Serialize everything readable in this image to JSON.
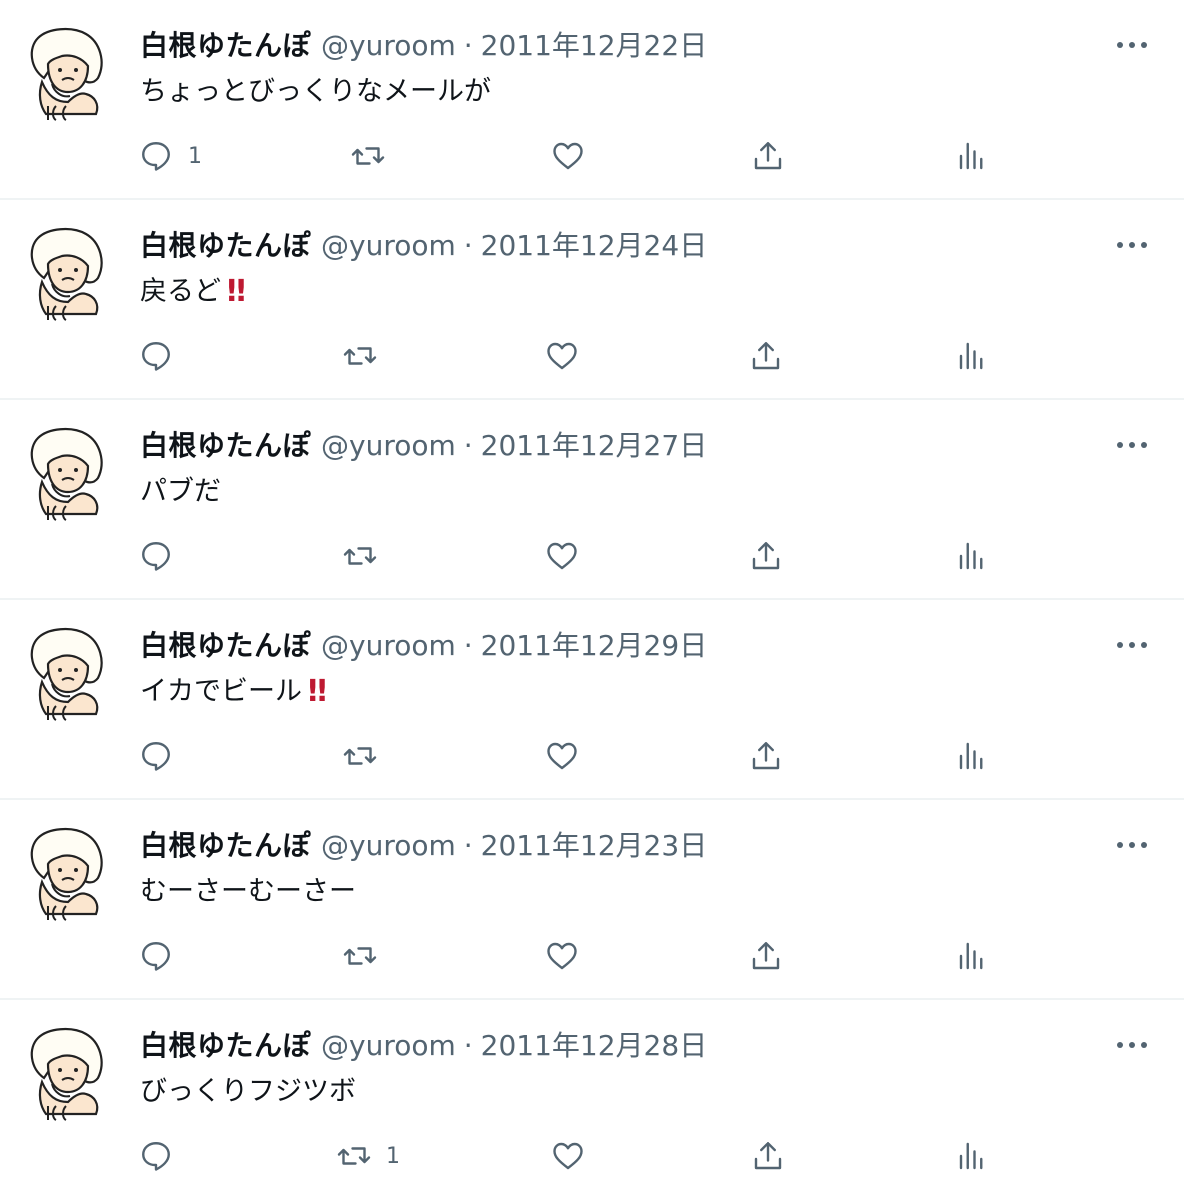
{
  "colors": {
    "text": "#0f1419",
    "secondary": "#536471",
    "divider": "#eff3f4",
    "emoji_red": "#be1931"
  },
  "icons": {
    "reply": "speech-bubble-icon",
    "retweet": "retweet-arrows-icon",
    "like": "heart-icon",
    "share": "share-upload-icon",
    "views": "bar-chart-icon",
    "more": "more-horizontal-icon"
  },
  "tweets": [
    {
      "name": "白根ゆたんぽ",
      "handle": "@yuroom",
      "separator": "·",
      "date": "2011年12月22日",
      "text": "ちょっとびっくりなメールが",
      "emoji": "",
      "reply_count": "1",
      "retweet_count": ""
    },
    {
      "name": "白根ゆたんぽ",
      "handle": "@yuroom",
      "separator": "·",
      "date": "2011年12月24日",
      "text": "戻るど",
      "emoji": "‼",
      "reply_count": "",
      "retweet_count": ""
    },
    {
      "name": "白根ゆたんぽ",
      "handle": "@yuroom",
      "separator": "·",
      "date": "2011年12月27日",
      "text": "パブだ",
      "emoji": "",
      "reply_count": "",
      "retweet_count": ""
    },
    {
      "name": "白根ゆたんぽ",
      "handle": "@yuroom",
      "separator": "·",
      "date": "2011年12月29日",
      "text": "イカでビール",
      "emoji": "‼",
      "reply_count": "",
      "retweet_count": ""
    },
    {
      "name": "白根ゆたんぽ",
      "handle": "@yuroom",
      "separator": "·",
      "date": "2011年12月23日",
      "text": "むーさーむーさー",
      "emoji": "",
      "reply_count": "",
      "retweet_count": ""
    },
    {
      "name": "白根ゆたんぽ",
      "handle": "@yuroom",
      "separator": "·",
      "date": "2011年12月28日",
      "text": "びっくりフジツボ",
      "emoji": "",
      "reply_count": "",
      "retweet_count": "1"
    }
  ]
}
